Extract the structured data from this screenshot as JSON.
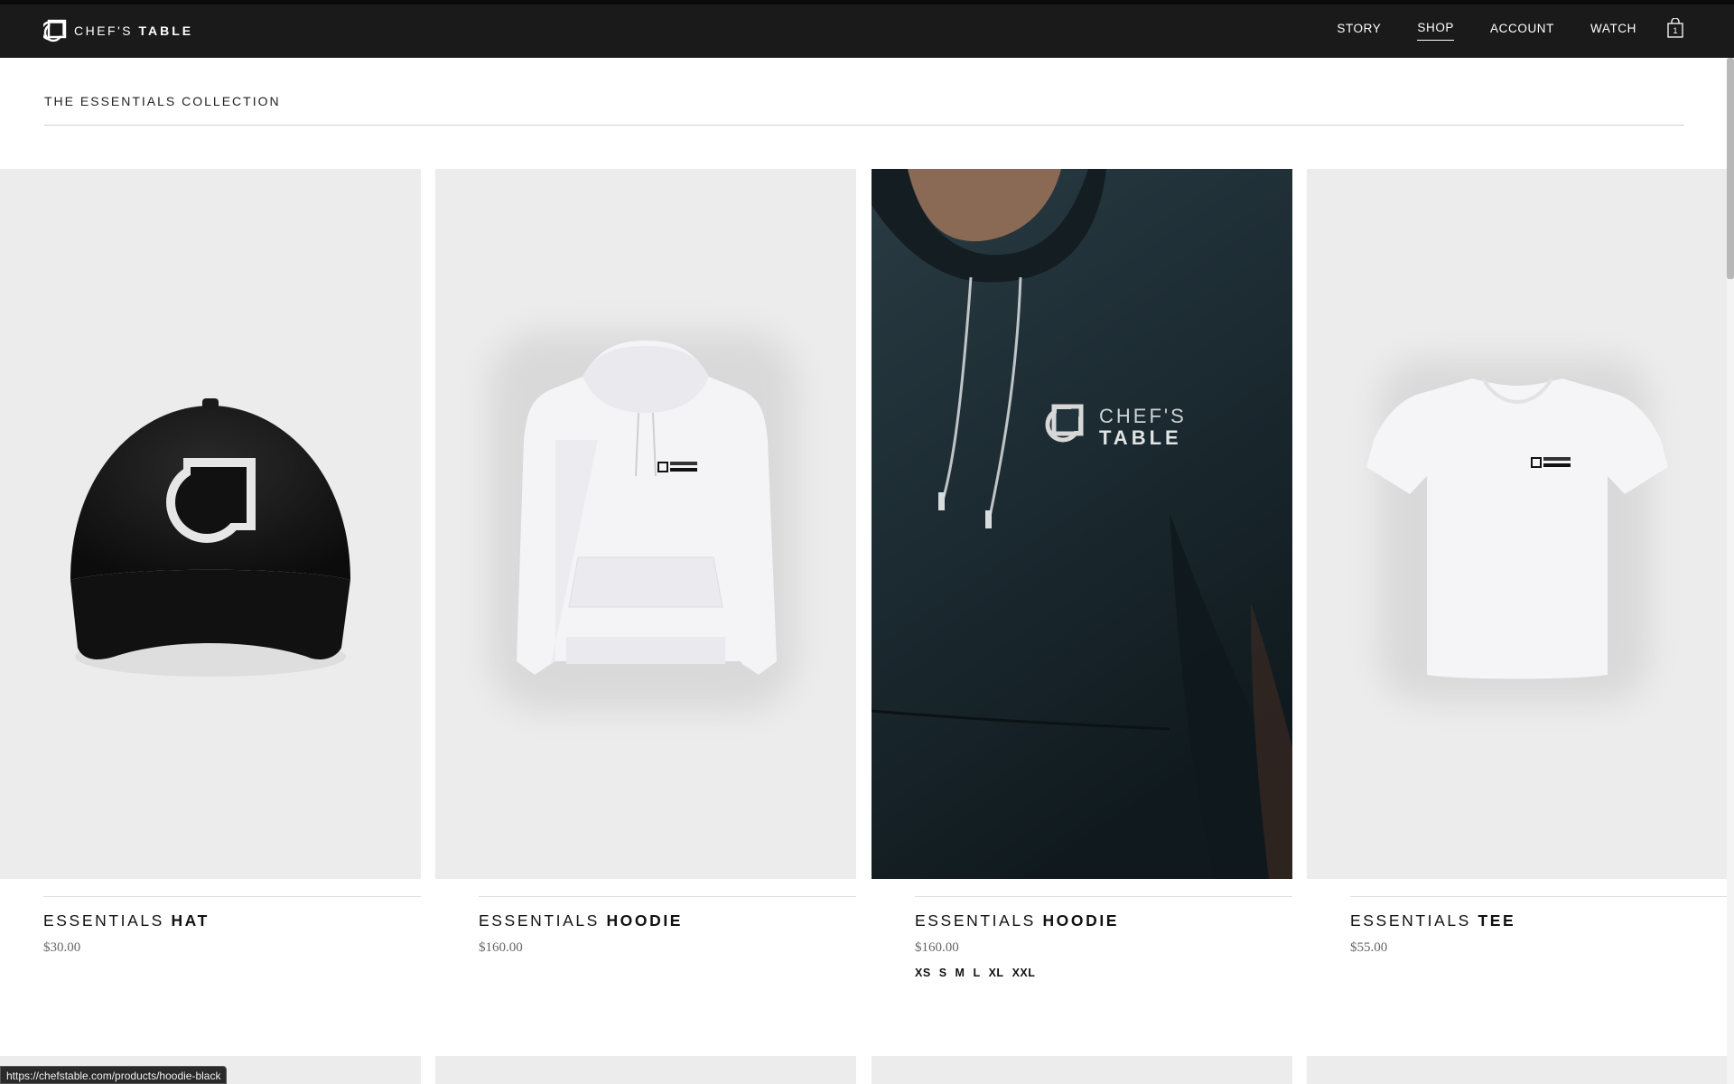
{
  "header": {
    "brand_light": "CHEF'S",
    "brand_bold": "TABLE",
    "nav": [
      {
        "label": "STORY"
      },
      {
        "label": "SHOP"
      },
      {
        "label": "ACCOUNT"
      },
      {
        "label": "WATCH"
      }
    ],
    "active_nav": "SHOP",
    "cart_count": "1"
  },
  "collection": {
    "title": "THE ESSENTIALS COLLECTION"
  },
  "products": [
    {
      "name_light": "ESSENTIALS",
      "name_bold": "HAT",
      "price": "$30.00",
      "image": "black-cap"
    },
    {
      "name_light": "ESSENTIALS",
      "name_bold": "HOODIE",
      "price": "$160.00",
      "image": "white-hoodie"
    },
    {
      "name_light": "ESSENTIALS",
      "name_bold": "HOODIE",
      "price": "$160.00",
      "image": "model-black-hoodie",
      "logo_line1": "CHEF'S",
      "logo_line2": "TABLE",
      "sizes": [
        "XS",
        "S",
        "M",
        "L",
        "XL",
        "XXL"
      ]
    },
    {
      "name_light": "ESSENTIALS",
      "name_bold": "TEE",
      "price": "$55.00",
      "image": "white-tee"
    }
  ],
  "status_bar": {
    "url": "https://chefstable.com/products/hoodie-black"
  },
  "colors": {
    "header_bg": "#1a1a1a",
    "tile_bg": "#ececec",
    "text": "#111111"
  }
}
